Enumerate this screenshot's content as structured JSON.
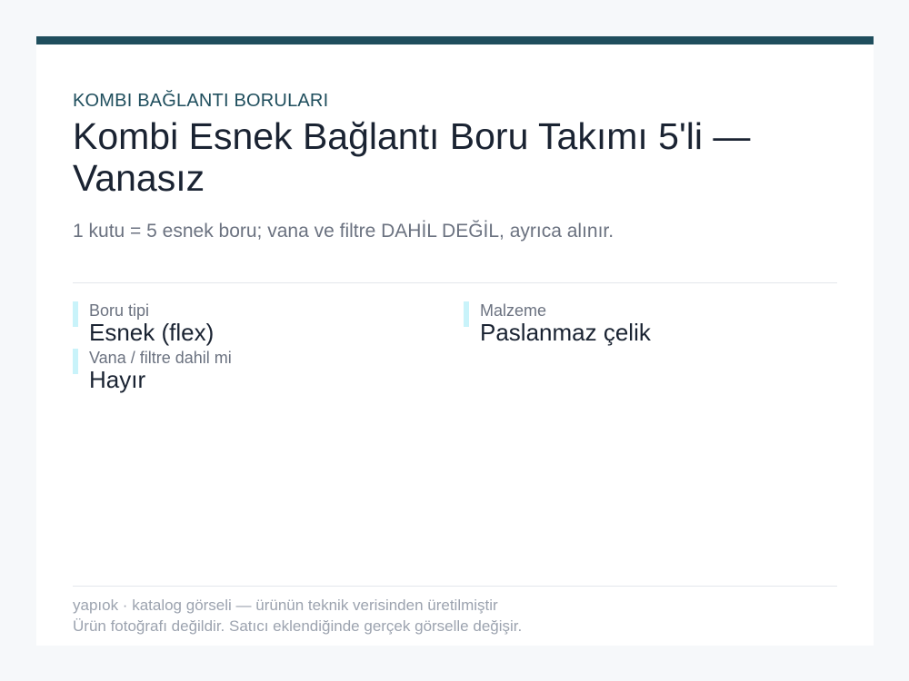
{
  "header": {
    "category": "KOMBI BAĞLANTI BORULARI",
    "title": "Kombi Esnek Bağlantı Boru Takımı 5'li — Vanasız",
    "subtitle": "1 kutu = 5 esnek boru; vana ve filtre DAHİL DEĞİL, ayrıca alınır."
  },
  "specs": [
    {
      "label": "Boru tipi",
      "value": "Esnek (flex)"
    },
    {
      "label": "Malzeme",
      "value": "Paslanmaz çelik"
    },
    {
      "label": "Vana / filtre dahil mi",
      "value": "Hayır"
    }
  ],
  "footer": {
    "line1": "yapıok · katalog görseli — ürünün teknik verisinden üretilmiştir",
    "line2": "Ürün fotoğrafı değildir. Satıcı eklendiğinde gerçek görselle değişir."
  },
  "colors": {
    "accent_bar": "#1f4e5d",
    "spec_marker": "#c9f3fa",
    "background": "#f6f8fa"
  }
}
